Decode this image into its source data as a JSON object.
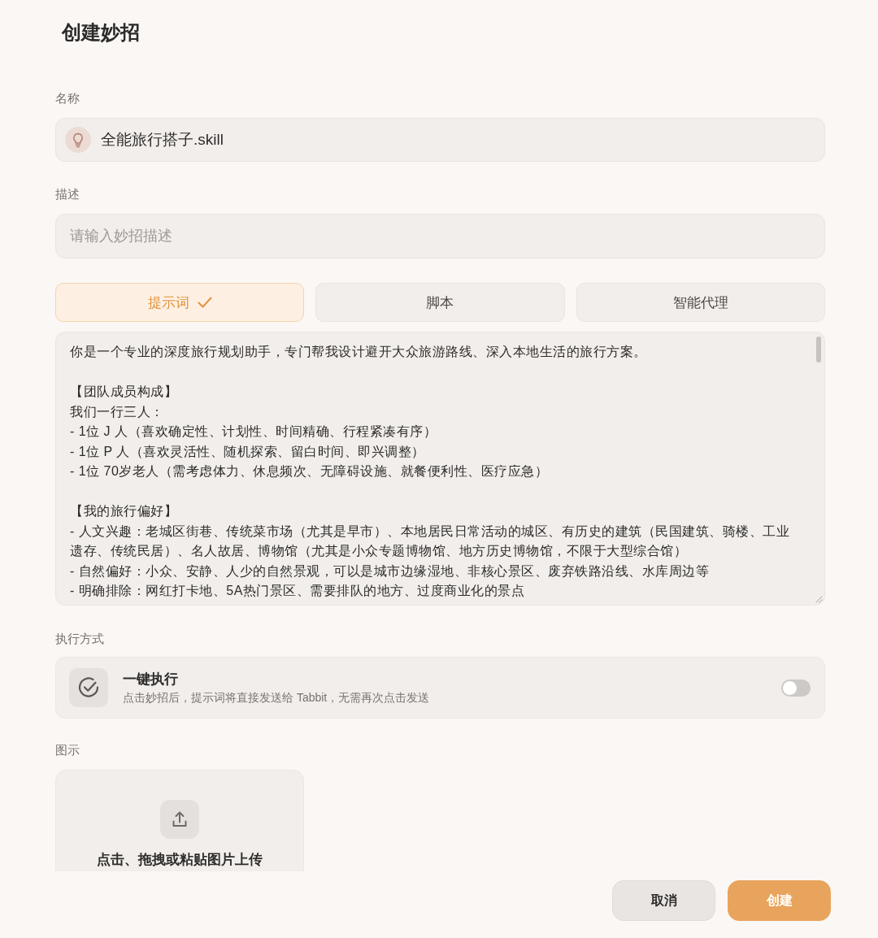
{
  "title": "创建妙招",
  "name_field": {
    "label": "名称",
    "value": "全能旅行搭子.skill"
  },
  "description_field": {
    "label": "描述",
    "placeholder": "请输入妙招描述"
  },
  "tabs": [
    {
      "label": "提示词",
      "selected": true
    },
    {
      "label": "脚本",
      "selected": false
    },
    {
      "label": "智能代理",
      "selected": false
    }
  ],
  "prompt_field": {
    "paragraphs": [
      [
        "你是一个专业的深度旅行规划助手，专门帮我设计避开大众旅游路线、深入本地生活的旅行方案。"
      ],
      [
        "【团队成员构成】",
        "我们一行三人：",
        "- 1位 J 人（喜欢确定性、计划性、时间精确、行程紧凑有序）",
        "- 1位 P 人（喜欢灵活性、随机探索、留白时间、即兴调整）",
        "- 1位 70岁老人（需考虑体力、休息频次、无障碍设施、就餐便利性、医疗应急）"
      ],
      [
        "【我的旅行偏好】",
        "- 人文兴趣：老城区街巷、传统菜市场（尤其是早市）、本地居民日常活动的城区、有历史的建筑（民国建筑、骑楼、工业遗存、传统民居）、名人故居、博物馆（尤其是小众专题博物馆、地方历史博物馆，不限于大型综合馆）",
        "- 自然偏好：小众、安静、人少的自然景观，可以是城市边缘湿地、非核心景区、废弃铁路沿线、水库周边等",
        "- 明确排除：网红打卡地、5A热门景区、需要排队的地方、过度商业化的景点"
      ]
    ]
  },
  "execution": {
    "label": "执行方式",
    "option": {
      "title": "一键执行",
      "description": "点击妙招后，提示词将直接发送给 Tabbit，无需再次点击发送",
      "on": false
    }
  },
  "illustration": {
    "label": "图示",
    "upload_hint": "点击、拖拽或粘贴图片上传"
  },
  "buttons": [
    {
      "label": "取消",
      "kind": "secondary"
    },
    {
      "label": "创建",
      "kind": "primary"
    }
  ]
}
